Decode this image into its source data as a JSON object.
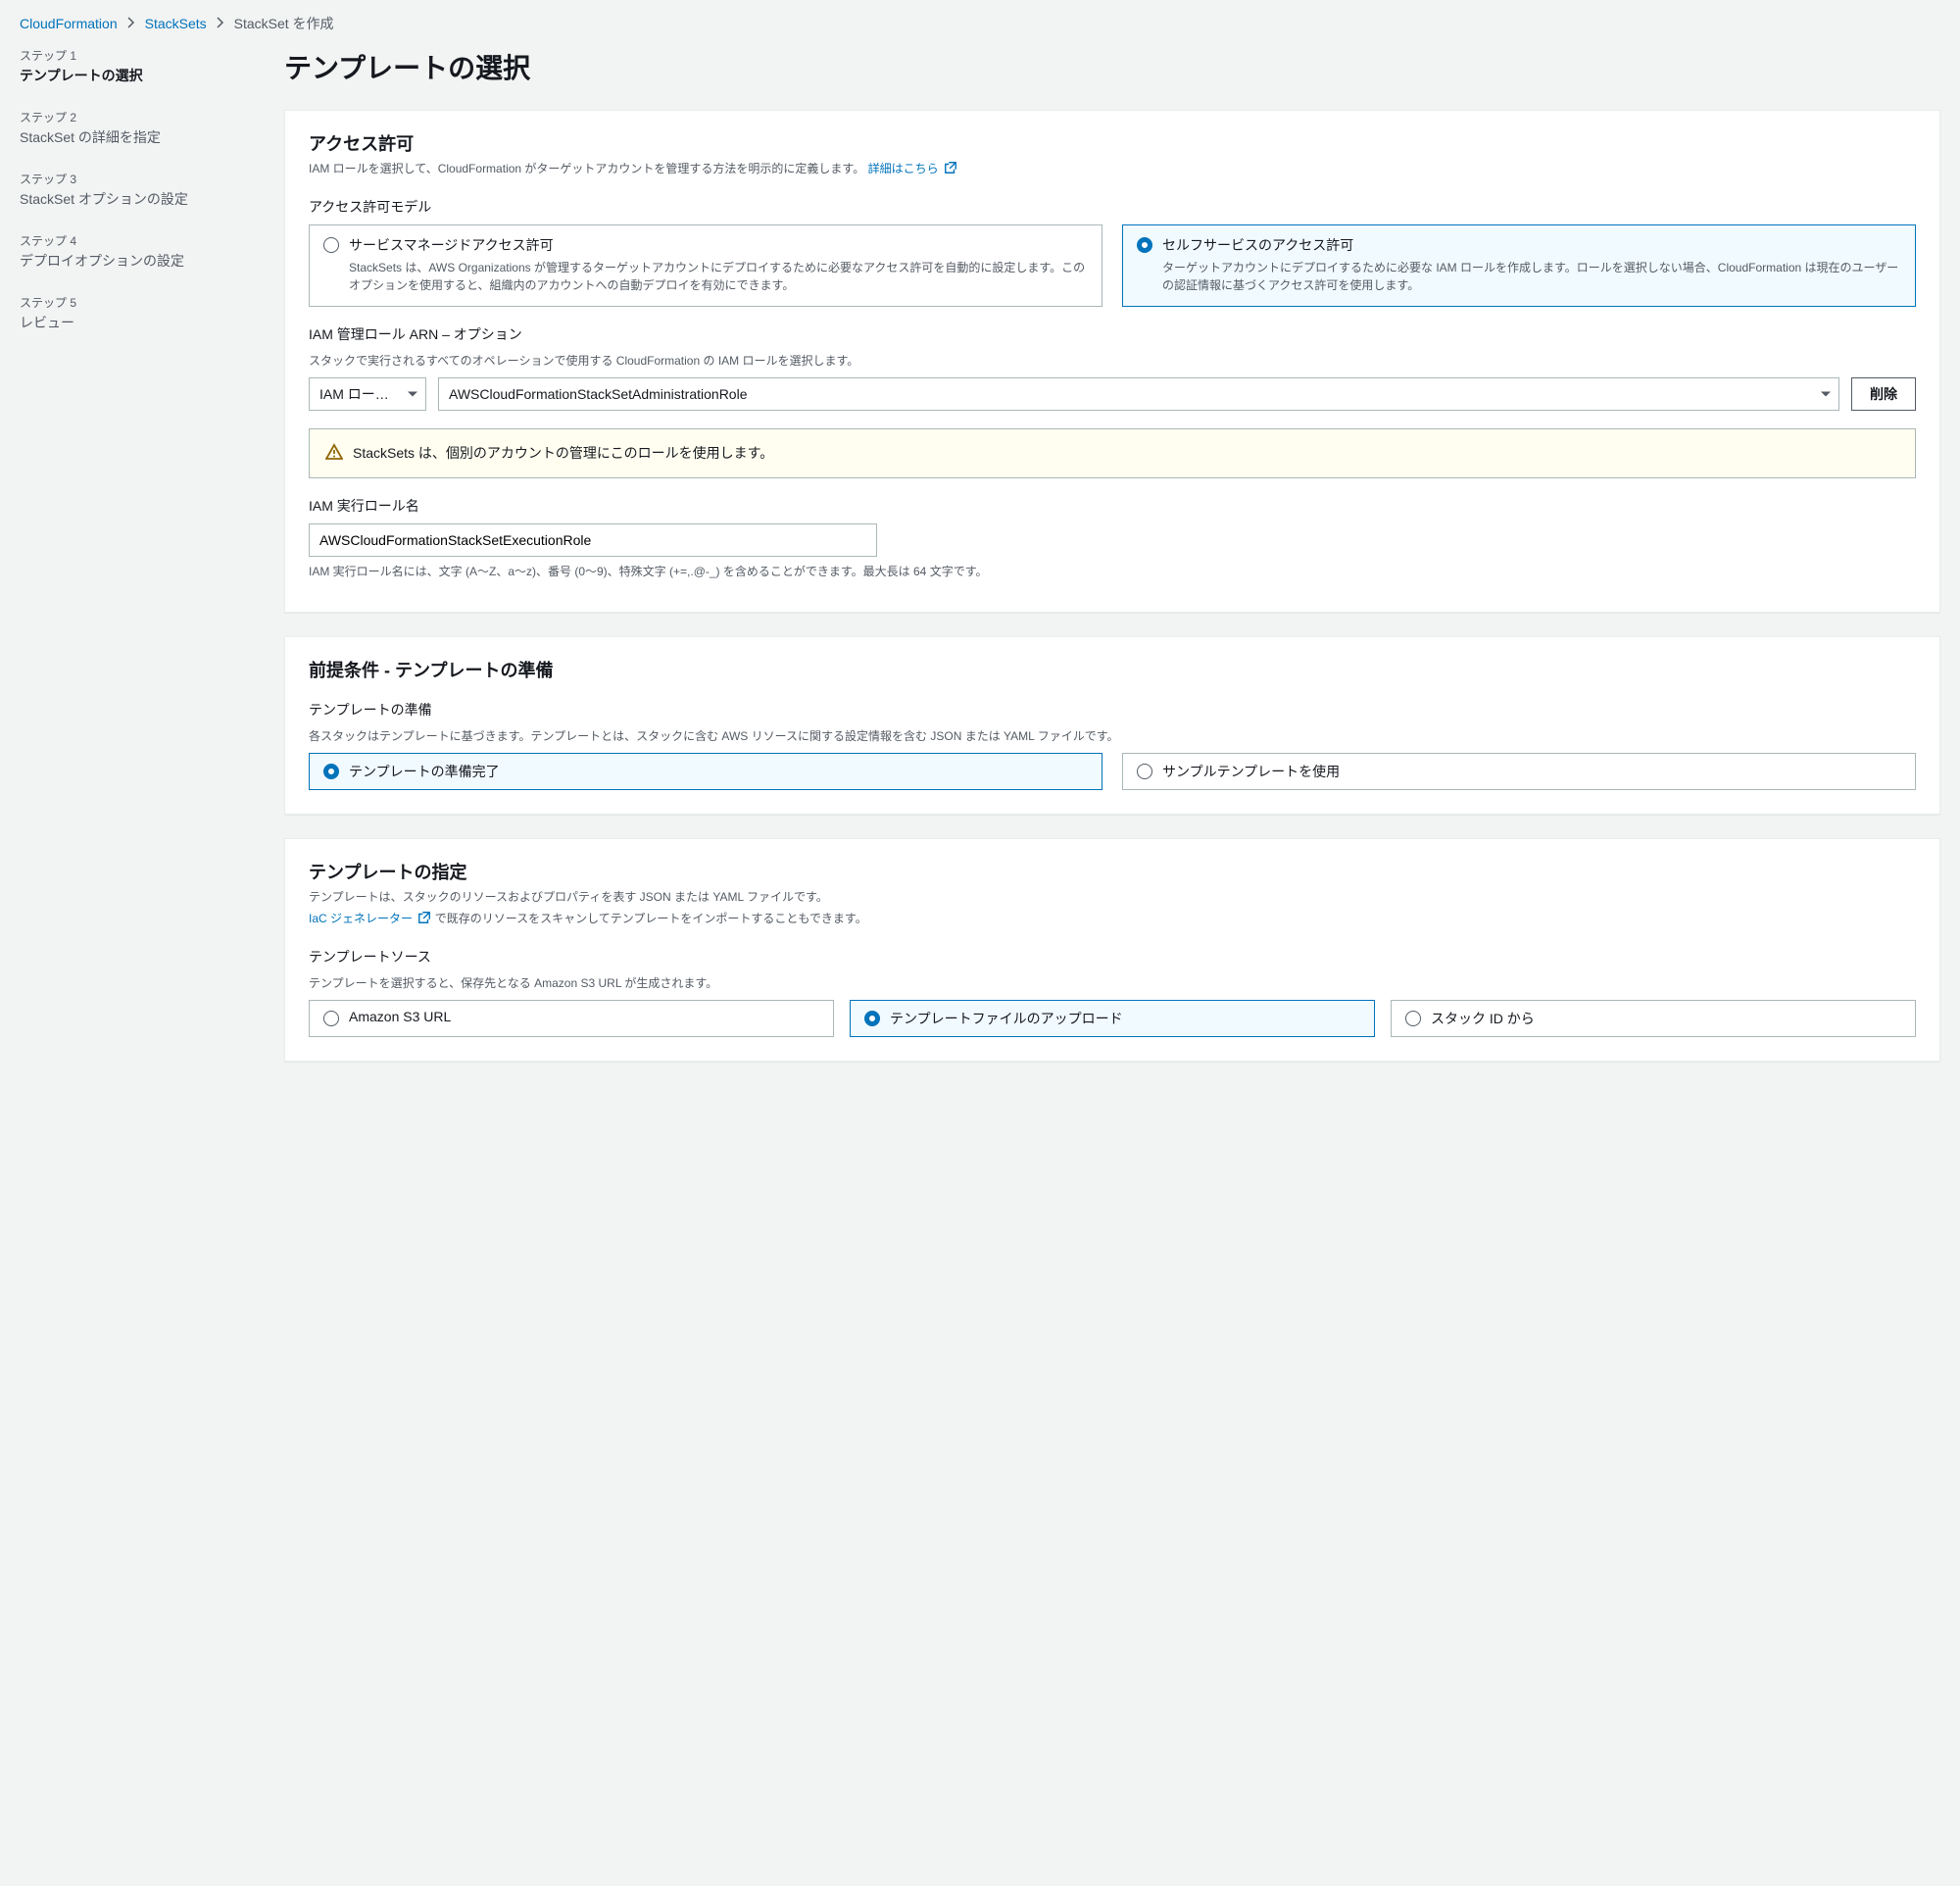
{
  "breadcrumb": {
    "cloudformation": "CloudFormation",
    "stacksets": "StackSets",
    "current": "StackSet を作成"
  },
  "sidebar": {
    "steps": [
      {
        "label": "ステップ 1",
        "title": "テンプレートの選択"
      },
      {
        "label": "ステップ 2",
        "title": "StackSet の詳細を指定"
      },
      {
        "label": "ステップ 3",
        "title": "StackSet オプションの設定"
      },
      {
        "label": "ステップ 4",
        "title": "デプロイオプションの設定"
      },
      {
        "label": "ステップ 5",
        "title": "レビュー"
      }
    ]
  },
  "page": {
    "title": "テンプレートの選択"
  },
  "permissions": {
    "header": "アクセス許可",
    "desc": "IAM ロールを選択して、CloudFormation がターゲットアカウントを管理する方法を明示的に定義します。 ",
    "learn_more": "詳細はこちら ",
    "model_label": "アクセス許可モデル",
    "tiles": [
      {
        "title": "サービスマネージドアクセス許可",
        "desc": "StackSets は、AWS Organizations が管理するターゲットアカウントにデプロイするために必要なアクセス許可を自動的に設定します。このオプションを使用すると、組織内のアカウントへの自動デプロイを有効にできます。"
      },
      {
        "title": "セルフサービスのアクセス許可",
        "desc": "ターゲットアカウントにデプロイするために必要な IAM ロールを作成します。ロールを選択しない場合、CloudFormation は現在のユーザーの認証情報に基づくアクセス許可を使用します。"
      }
    ],
    "admin_role_label": "IAM 管理ロール ARN – オプション",
    "admin_role_hint": "スタックで実行されるすべてのオペレーションで使用する CloudFormation の IAM ロールを選択します。",
    "role_type_select": "IAM ロー…",
    "role_select_value": "AWSCloudFormationStackSetAdministrationRole",
    "delete_button": "削除",
    "alert": "StackSets は、個別のアカウントの管理にこのロールを使用します。",
    "exec_role_label": "IAM 実行ロール名",
    "exec_role_value": "AWSCloudFormationStackSetExecutionRole",
    "exec_role_hint": "IAM 実行ロール名には、文字 (A〜Z、a〜z)、番号 (0〜9)、特殊文字 (+=,.@-_) を含めることができます。最大長は 64 文字です。"
  },
  "prereq": {
    "header": "前提条件 - テンプレートの準備",
    "section_label": "テンプレートの準備",
    "section_hint": "各スタックはテンプレートに基づきます。テンプレートとは、スタックに含む AWS リソースに関する設定情報を含む JSON または YAML ファイルです。",
    "tiles": [
      {
        "title": "テンプレートの準備完了"
      },
      {
        "title": "サンプルテンプレートを使用"
      }
    ]
  },
  "specify": {
    "header": "テンプレートの指定",
    "desc_line1": "テンプレートは、スタックのリソースおよびプロパティを表す JSON または YAML ファイルです。",
    "iac_link": "IaC ジェネレーター ",
    "desc_line2": " で既存のリソースをスキャンしてテンプレートをインポートすることもできます。",
    "source_label": "テンプレートソース",
    "source_hint": "テンプレートを選択すると、保存先となる Amazon S3 URL が生成されます。",
    "tiles": [
      {
        "title": "Amazon S3 URL"
      },
      {
        "title": "テンプレートファイルのアップロード"
      },
      {
        "title": "スタック ID から"
      }
    ]
  }
}
